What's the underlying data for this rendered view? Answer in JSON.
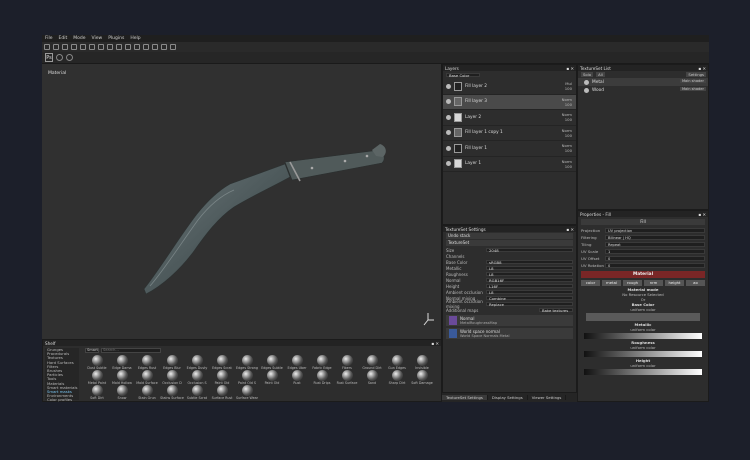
{
  "menu": [
    "File",
    "Edit",
    "Mode",
    "View",
    "Plugins",
    "Help"
  ],
  "viewport": {
    "label": "Material"
  },
  "layers": {
    "title": "Layers",
    "channel": "Base Color",
    "rows": [
      {
        "name": "Fill layer 2",
        "blend": "Mul",
        "opacity": "100",
        "thumb": "dark",
        "selected": false
      },
      {
        "name": "Fill layer 3",
        "blend": "Norm",
        "opacity": "100",
        "thumb": "mid",
        "selected": true
      },
      {
        "name": "Layer 2",
        "blend": "Norm",
        "opacity": "100",
        "thumb": "light",
        "selected": false
      },
      {
        "name": "Fill layer 1 copy 1",
        "blend": "Norm",
        "opacity": "100",
        "thumb": "mid",
        "selected": false
      },
      {
        "name": "Fill layer 1",
        "blend": "Norm",
        "opacity": "100",
        "thumb": "dark",
        "selected": false
      },
      {
        "name": "Layer 1",
        "blend": "Norm",
        "opacity": "100",
        "thumb": "light",
        "selected": false
      }
    ]
  },
  "tss": {
    "title": "TextureSet Settings",
    "stack": "Undo stack",
    "textureset": "TextureSet",
    "size_label": "Size",
    "size_value": "2048",
    "channels_label": "Channels",
    "channels": [
      {
        "label": "Base Color",
        "value": "sRGB8"
      },
      {
        "label": "Metallic",
        "value": "L8"
      },
      {
        "label": "Roughness",
        "value": "L8"
      },
      {
        "label": "Normal",
        "value": "RGB16F"
      },
      {
        "label": "Height",
        "value": "L16F"
      },
      {
        "label": "Ambient occlusion",
        "value": "L8"
      }
    ],
    "normal_mixing_label": "Normal mixing",
    "normal_mixing": "Combine",
    "ao_mixing_label": "Ambient occlusion mixing",
    "ao_mixing": "Replace",
    "additional_label": "Additional maps",
    "bake_button": "Bake textures",
    "maps": [
      {
        "title": "Normal",
        "sub": "MetalRoughnessMap"
      },
      {
        "title": "World space normal",
        "sub": "World Space Normals Metal"
      }
    ]
  },
  "bottom_tabs": [
    "TextureSet Settings",
    "Display Settings",
    "Viewer Settings"
  ],
  "tslist": {
    "title": "TextureSet List",
    "solo": "Solo",
    "all": "All",
    "settings": "Settings",
    "rows": [
      {
        "name": "Metal",
        "shader": "Main shader",
        "selected": true
      },
      {
        "name": "Wood",
        "shader": "Main shader",
        "selected": false
      }
    ]
  },
  "props": {
    "title": "Properties - Fill",
    "fill": "Fill",
    "fields": [
      {
        "label": "Projection",
        "value": "UV projection"
      },
      {
        "label": "Filtering",
        "value": "Bilinear | HQ"
      },
      {
        "label": "Tiling",
        "value": "Repeat"
      },
      {
        "label": "UV Scale",
        "value": "1"
      },
      {
        "label": "UV Offset",
        "value": "0"
      },
      {
        "label": "UV Rotation",
        "value": "0"
      }
    ],
    "material": "Material",
    "channels": [
      "color",
      "metal",
      "rough",
      "nrm",
      "height",
      "ao"
    ],
    "mode_title": "Material mode",
    "mode_text": "No Resource Selected",
    "or": "Or",
    "base_title": "Base Color",
    "uniform": "uniform color",
    "metallic_title": "Metallic",
    "roughness_title": "Roughness",
    "height_title": "Height"
  },
  "shelf": {
    "title": "Shelf",
    "search_prefix": "Smart",
    "search_placeholder": "Search...",
    "categories": [
      "Grunges",
      "Procedurals",
      "Textures",
      "Hard Surfaces",
      "Filters",
      "Brushes",
      "Particles",
      "Tools",
      "Materials",
      "Smart materials",
      "Smart masks",
      "Environments",
      "Color profiles"
    ],
    "selected_category": "Smart masks",
    "items": [
      "Dust Subtle",
      "Edge Dama",
      "Edges Rust",
      "Edges Blur",
      "Edges Dusty",
      "Edges Scrat",
      "Edges Strong",
      "Edges Subtle",
      "Edges Uber",
      "Fabric Edge",
      "Fibers",
      "Ground Dirt",
      "Gun Edges",
      "Invisible",
      "Metal Paint",
      "Mold Hollow",
      "Mold Surface",
      "Occlusion D",
      "Occlusion S",
      "Paint Old",
      "Paint Old S",
      "Paint Old",
      "Rust",
      "Rust Drips",
      "Rust Surface",
      "Sand",
      "Sharp Dirt",
      "Soft Damage",
      "Soft Dirt",
      "Snow",
      "Stain Grun",
      "Stains Surface",
      "Subtle Scrat",
      "Surface Rust",
      "Surface Wear"
    ]
  }
}
